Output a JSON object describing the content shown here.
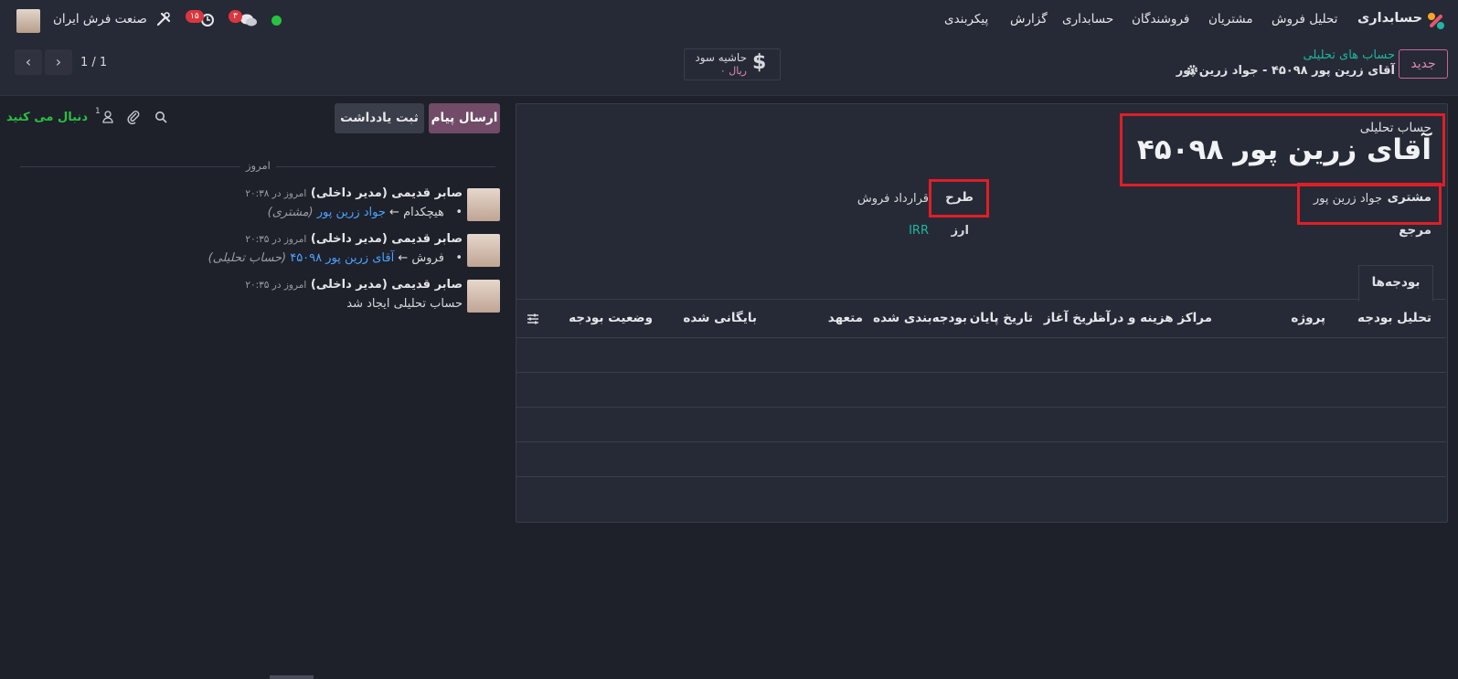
{
  "topbar": {
    "app_name": "حسابداری",
    "menu": [
      "تحلیل فروش",
      "مشتریان",
      "فروشندگان",
      "حسابداری",
      "گزارش",
      "پیکربندی"
    ],
    "company": "صنعت فرش ایران",
    "chat_badge": "۳",
    "activity_badge": "۱۵"
  },
  "control_panel": {
    "new_button": "جدید",
    "breadcrumb_parent": "حساب های تحلیلی",
    "breadcrumb_current": "آقای زرین پور ۴۵۰۹۸ - جواد زرین پور",
    "pager": "1 / 1",
    "smart_button": {
      "label": "حاشیه سود",
      "value": "ریال ۰"
    }
  },
  "form": {
    "type_label": "حساب تحلیلی",
    "title": "آقای زرین پور ۴۵۰۹۸",
    "customer_label": "مشتری",
    "customer_value": "جواد زرین پور",
    "plan_label": "طرح",
    "plan_value": "قرارداد فروش",
    "reference_label": "مرجع",
    "currency_label": "ارز",
    "currency_value": "IRR",
    "tab_budgets": "بودجه‌ها",
    "columns": [
      "تحلیل بودجه",
      "پروژه",
      "مراکز هزینه و درآمد",
      "تاریخ آغاز",
      "تاریخ پایان",
      "بودجه‌بندی شده",
      "متعهد",
      "بایگانی شده",
      "وضعیت بودجه"
    ]
  },
  "chatter": {
    "send_message": "ارسال پیام",
    "log_note": "ثبت یادداشت",
    "follow": "دنبال می کنید",
    "followers_count": "1",
    "date_separator": "امروز",
    "messages": [
      {
        "author": "صابر قدیمی (مدیر داخلی)",
        "time": "امروز در ۲۰:۳۸",
        "old": "هیچکدام",
        "arrow": "←",
        "new": "جواد زرین پور",
        "field": "(مشتری)"
      },
      {
        "author": "صابر قدیمی (مدیر داخلی)",
        "time": "امروز در ۲۰:۳۵",
        "old": "فروش",
        "arrow": "←",
        "new": "آقای زرین پور ۴۵۰۹۸",
        "field": "(حساب تحلیلی)"
      },
      {
        "author": "صابر قدیمی (مدیر داخلی)",
        "time": "امروز در ۲۰:۳۵",
        "text": "حساب تحلیلی ایجاد شد"
      }
    ]
  }
}
